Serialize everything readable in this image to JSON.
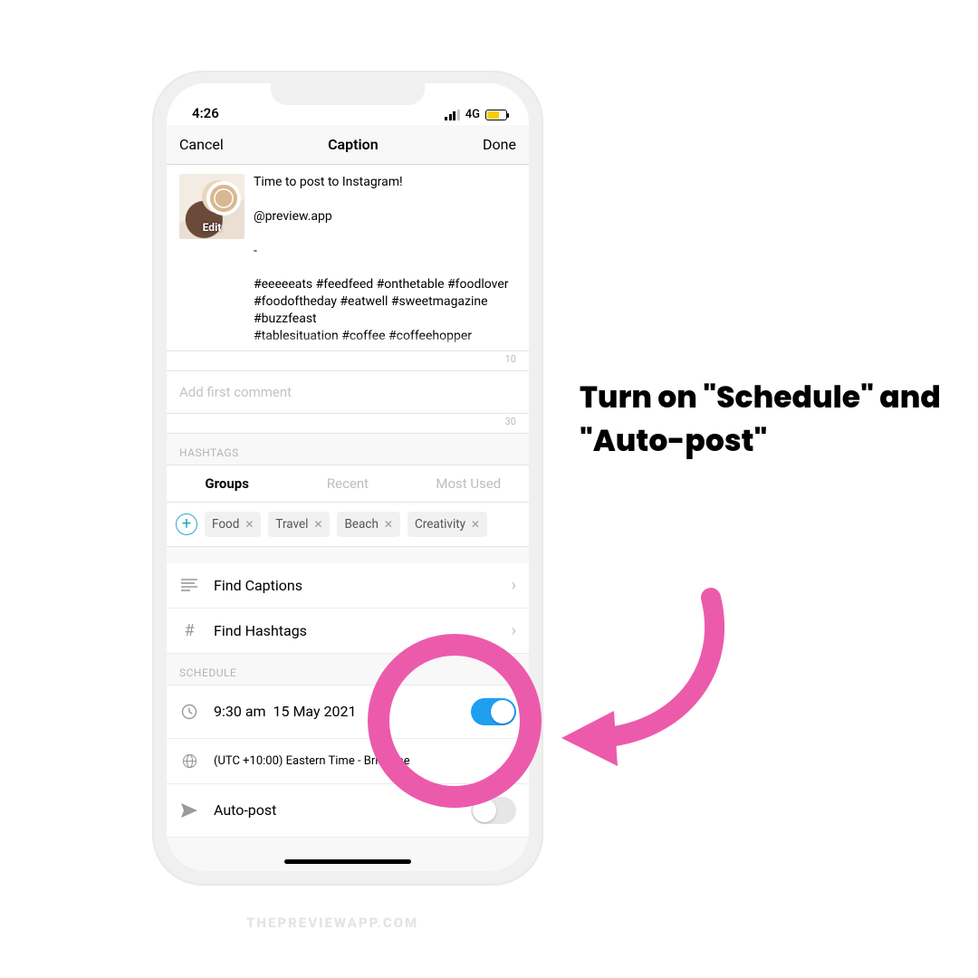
{
  "statusbar": {
    "time": "4:26",
    "network": "4G"
  },
  "nav": {
    "cancel": "Cancel",
    "title": "Caption",
    "done": "Done"
  },
  "thumbnail": {
    "edit_label": "Edit"
  },
  "caption": {
    "text": "Time to post to Instagram!\n\n@preview.app\n\n-\n\n#eeeeeats #feedfeed #onthetable #foodlover #foodoftheday #eatwell #sweetmagazine #buzzfeast\n#tablesituation #coffee #coffeehopper",
    "counter": "10"
  },
  "first_comment": {
    "placeholder": "Add first comment",
    "counter": "30"
  },
  "hashtags": {
    "section_label": "HASHTAGS",
    "tabs": {
      "groups": "Groups",
      "recent": "Recent",
      "most_used": "Most Used"
    },
    "chips": [
      "Food",
      "Travel",
      "Beach",
      "Creativity"
    ]
  },
  "find": {
    "captions": "Find Captions",
    "hashtags": "Find Hashtags"
  },
  "schedule": {
    "section_label": "SCHEDULE",
    "time": "9:30 am",
    "date": "15 May 2021",
    "timezone": "(UTC +10:00) Eastern Time - Brisbane",
    "autopost_label": "Auto-post"
  },
  "annotation": {
    "text": "Turn on \"Schedule\" and \"Auto-post\""
  },
  "watermark": "THEPREVIEWAPP.COM",
  "colors": {
    "accent": "#1e9ff0",
    "pink": "#ec5bab",
    "chip_icon": "#2aa7c8"
  }
}
